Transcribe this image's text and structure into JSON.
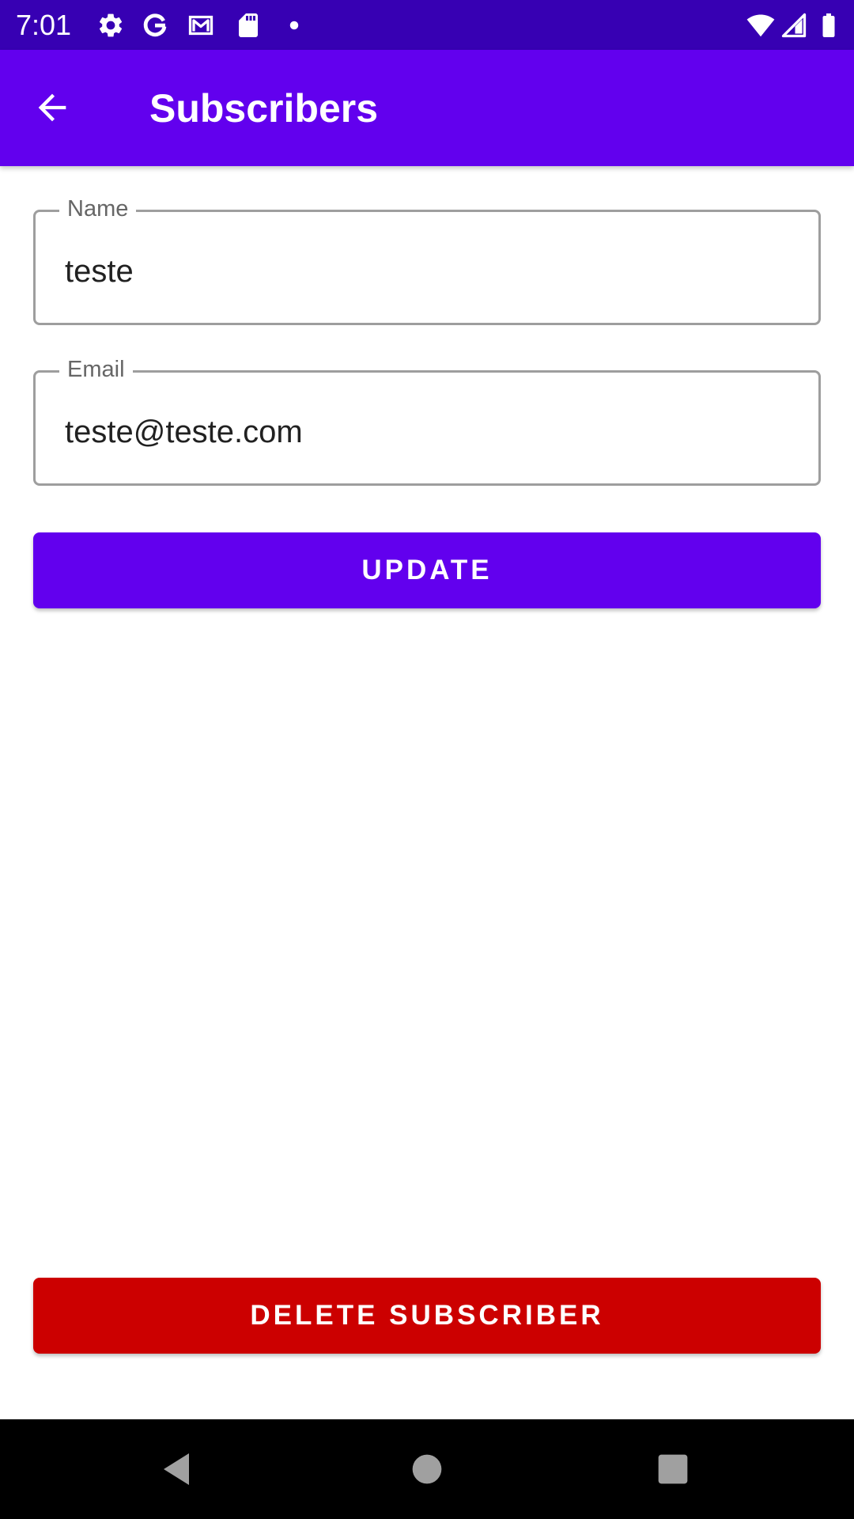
{
  "status_bar": {
    "time": "7:01",
    "background": "#3700b3",
    "left_icons": [
      "settings-icon",
      "google-icon",
      "gmail-icon",
      "sd-card-icon",
      "notification-dot-icon"
    ],
    "right_icons": [
      "wifi-icon",
      "cell-signal-icon",
      "battery-icon"
    ]
  },
  "app_bar": {
    "title": "Subscribers",
    "background": "#6200ee",
    "back_icon": "arrow-back-icon"
  },
  "form": {
    "name": {
      "label": "Name",
      "value": "teste"
    },
    "email": {
      "label": "Email",
      "value": "teste@teste.com"
    }
  },
  "buttons": {
    "update_label": "UPDATE",
    "update_color": "#6200ee",
    "delete_label": "DELETE SUBSCRIBER",
    "delete_color": "#cc0000"
  },
  "nav_bar": {
    "icons": [
      "back-triangle-icon",
      "home-circle-icon",
      "recents-square-icon"
    ]
  }
}
